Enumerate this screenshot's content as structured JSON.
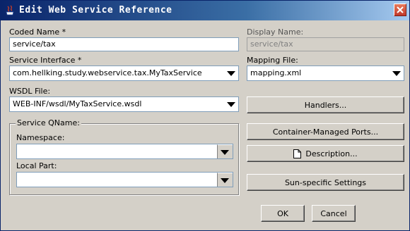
{
  "window": {
    "title": "Edit Web Service Reference"
  },
  "form": {
    "coded_name_label": "Coded Name *",
    "coded_name_value": "service/tax",
    "display_name_label": "Display Name:",
    "display_name_value": "service/tax",
    "service_interface_label": "Service Interface *",
    "service_interface_value": "com.hellking.study.webservice.tax.MyTaxService",
    "mapping_file_label": "Mapping File:",
    "mapping_file_value": "mapping.xml",
    "wsdl_file_label": "WSDL File:",
    "wsdl_file_value": "WEB-INF/wsdl/MyTaxService.wsdl",
    "qname_group_label": "Service QName:",
    "namespace_label": "Namespace:",
    "namespace_value": "",
    "local_part_label": "Local Part:",
    "local_part_value": ""
  },
  "buttons": {
    "handlers": "Handlers...",
    "container_ports": "Container-Managed Ports...",
    "description": "Description...",
    "sun_settings": "Sun-specific Settings",
    "ok": "OK",
    "cancel": "Cancel"
  },
  "icons": {
    "app": "java-cup-icon",
    "close": "close-icon",
    "dropdown": "chevron-down-icon",
    "document": "document-icon"
  },
  "colors": {
    "titlebar_start": "#0a246a",
    "titlebar_end": "#a6caf0",
    "dialog_bg": "#d4d0c8",
    "close_button": "#c0392b"
  }
}
